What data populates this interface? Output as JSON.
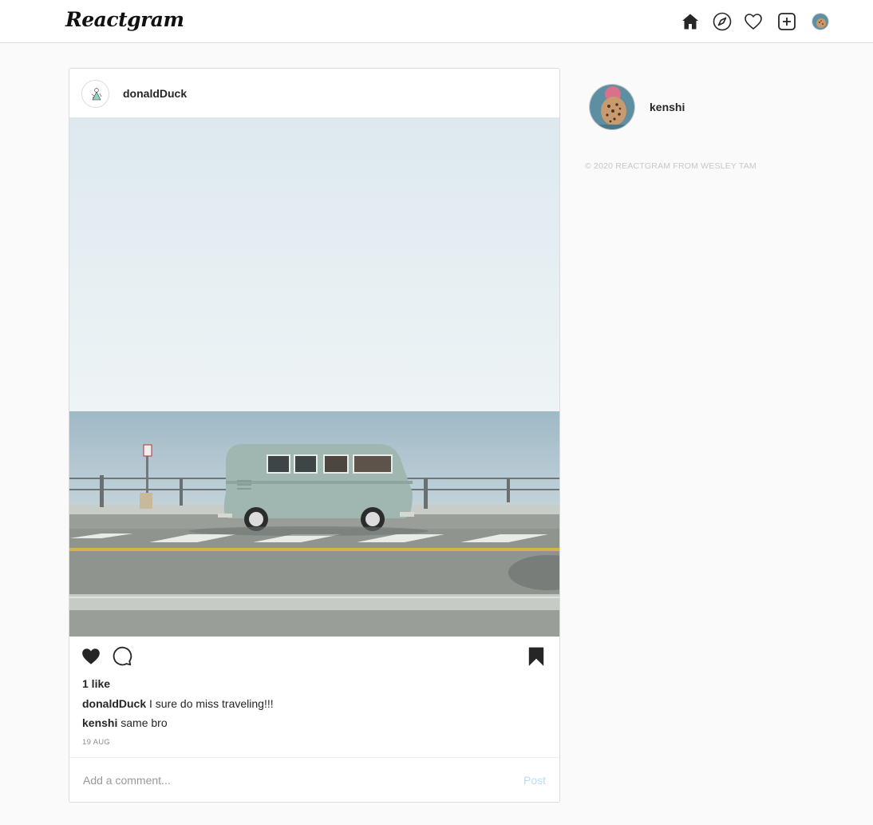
{
  "app": {
    "logo": "Reactgram"
  },
  "nav": {
    "items": [
      {
        "icon": "home-icon"
      },
      {
        "icon": "explore-icon"
      },
      {
        "icon": "heart-icon"
      },
      {
        "icon": "new-post-icon"
      },
      {
        "icon": "profile-avatar"
      }
    ]
  },
  "post": {
    "username": "donaldDuck",
    "likes": "1 like",
    "caption": {
      "user": "donaldDuck",
      "text": "I sure do miss traveling!!!"
    },
    "comments": [
      {
        "user": "kenshi",
        "text": "same bro"
      }
    ],
    "date": "19 AUG",
    "comment_placeholder": "Add a comment...",
    "post_button": "Post",
    "liked": true,
    "saved": true
  },
  "sidebar": {
    "username": "kenshi",
    "footer": "© 2020 REACTGRAM FROM WESLEY TAM"
  },
  "colors": {
    "border": "#dbdbdb",
    "post_button": "#b2dffc",
    "muted": "#8e8e8e"
  }
}
